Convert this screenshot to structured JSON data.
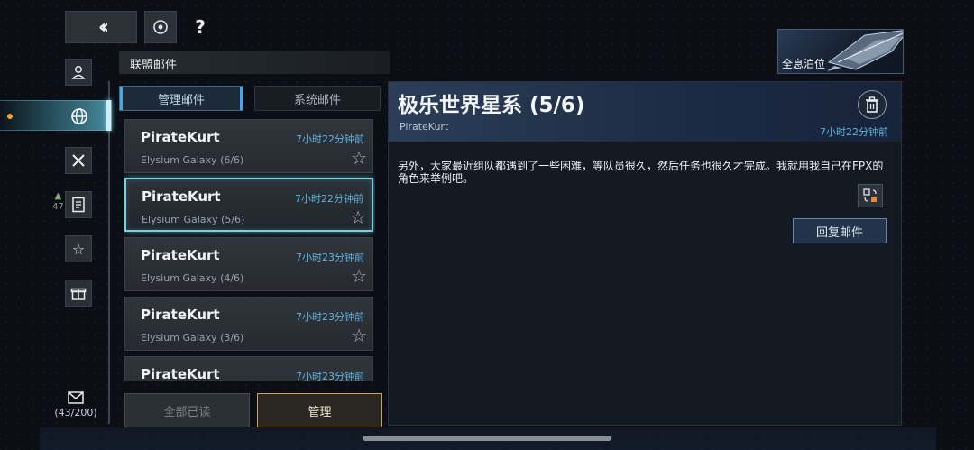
{
  "window": {
    "holo_label": "全息泊位"
  },
  "header": {
    "section_title": "联盟邮件",
    "help_symbol": "?"
  },
  "sidebar": {
    "warning_count": "47",
    "mail_count": "(43/200)",
    "items": [
      {
        "icon": "person-icon"
      },
      {
        "icon": "globe-icon",
        "active": true
      },
      {
        "icon": "crossed-swords-icon"
      },
      {
        "icon": "document-icon"
      },
      {
        "icon": "star-icon"
      },
      {
        "icon": "gift-icon"
      }
    ]
  },
  "tabs": [
    {
      "label": "管理邮件",
      "active": true
    },
    {
      "label": "系统邮件",
      "active": false
    }
  ],
  "mails": [
    {
      "sender": "PirateKurt",
      "time": "7小时22分钟前",
      "subject": "Elysium Galaxy (6/6)"
    },
    {
      "sender": "PirateKurt",
      "time": "7小时22分钟前",
      "subject": "Elysium Galaxy (5/6)"
    },
    {
      "sender": "PirateKurt",
      "time": "7小时23分钟前",
      "subject": "Elysium Galaxy (4/6)"
    },
    {
      "sender": "PirateKurt",
      "time": "7小时23分钟前",
      "subject": "Elysium Galaxy (3/6)"
    },
    {
      "sender": "PirateKurt",
      "time": "7小时23分钟前",
      "subject": ""
    }
  ],
  "buttons": {
    "read_all": "全部已读",
    "manage": "管理",
    "reply": "回复邮件"
  },
  "detail": {
    "title": "极乐世界星系 (5/6)",
    "from": "PirateKurt",
    "time": "7小时22分钟前",
    "body": "另外，大家最近组队都遇到了一些困难，等队员很久，然后任务也很久才完成。我就用我自己在FPX的角色来举例吧。"
  },
  "colors": {
    "accent_cyan": "#7fd0dc",
    "time_blue": "#5fb4de",
    "manage_gold": "#c9a45a",
    "notify_orange": "#f0a630"
  }
}
